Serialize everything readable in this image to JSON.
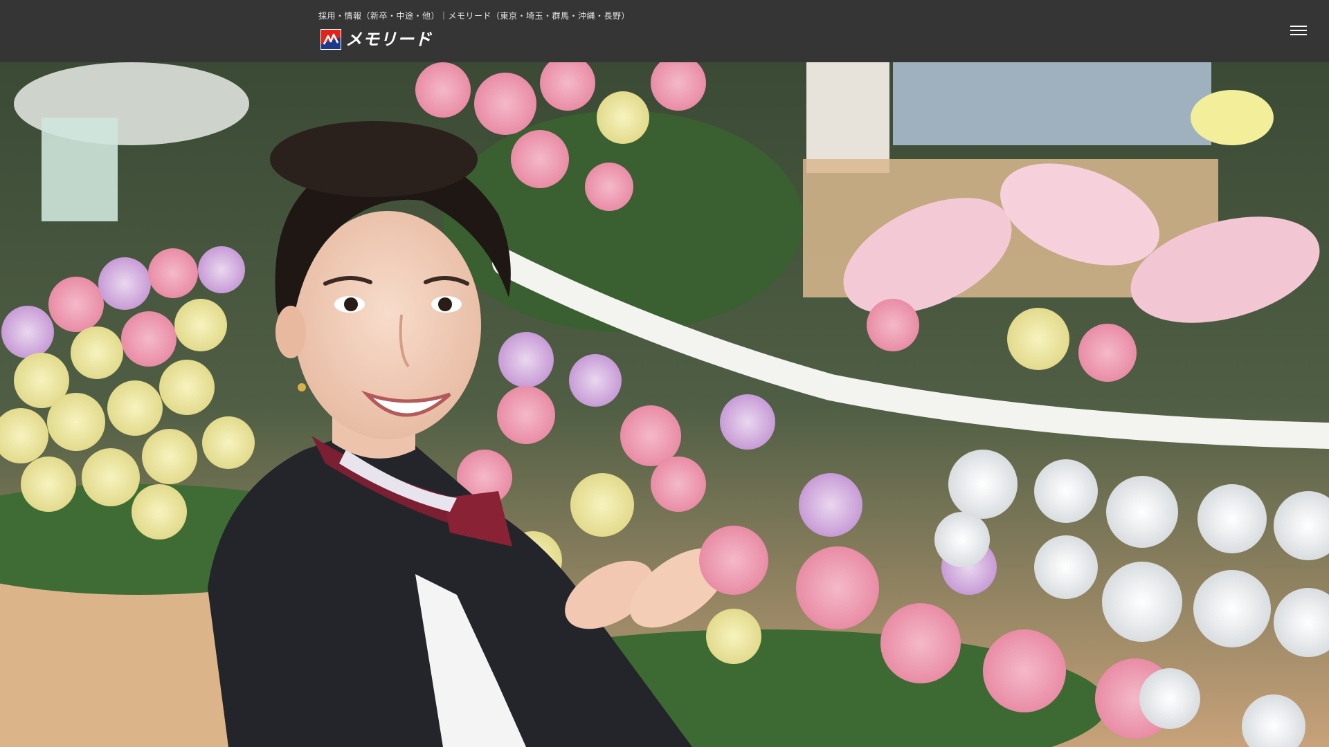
{
  "header": {
    "tagline": "採用・情報（新卒・中途・他）｜メモリード（東京・埼玉・群馬・沖縄・長野）",
    "logo_text": "メモリード",
    "logo_icon": "memolead-logo-icon",
    "menu_icon": "hamburger-menu-icon"
  },
  "hero": {
    "image": "photo-staff-smiling-with-funeral-flower-altar"
  },
  "colors": {
    "header_bg": "#353535",
    "logo_red": "#e2231a",
    "logo_blue": "#1b3a8c"
  }
}
